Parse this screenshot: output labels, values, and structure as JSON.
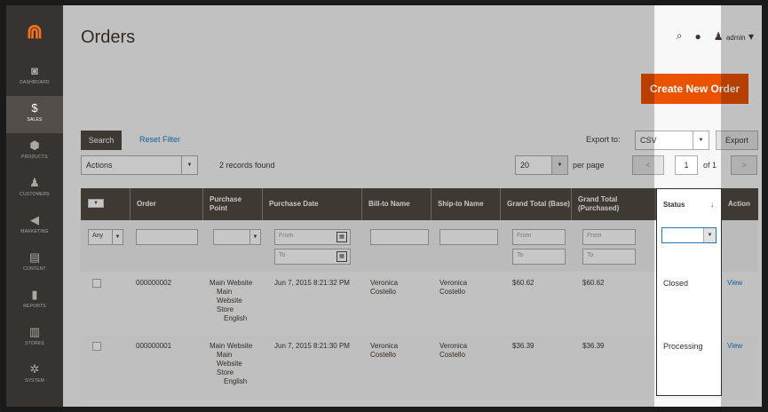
{
  "app": {
    "title": "Orders",
    "create_button": "Create New Order",
    "user": "admin"
  },
  "sidebar": {
    "items": [
      {
        "icon": "dashboard-icon",
        "glyph": "◙",
        "label": "DASHBOARD"
      },
      {
        "icon": "dollar-icon",
        "glyph": "$",
        "label": "SALES",
        "active": true
      },
      {
        "icon": "box-icon",
        "glyph": "⬢",
        "label": "PRODUCTS"
      },
      {
        "icon": "person-icon",
        "glyph": "♟",
        "label": "CUSTOMERS"
      },
      {
        "icon": "megaphone-icon",
        "glyph": "◀",
        "label": "MARKETING"
      },
      {
        "icon": "content-icon",
        "glyph": "▤",
        "label": "CONTENT"
      },
      {
        "icon": "bar-chart-icon",
        "glyph": "▮",
        "label": "REPORTS"
      },
      {
        "icon": "store-icon",
        "glyph": "▥",
        "label": "STORES"
      },
      {
        "icon": "gear-icon",
        "glyph": "✲",
        "label": "SYSTEM"
      }
    ]
  },
  "toolbar": {
    "search": "Search",
    "reset": "Reset Filter",
    "export_to": "Export to:",
    "export_format": "CSV",
    "export": "Export",
    "actions": "Actions",
    "records": "2 records found",
    "per_page_value": "20",
    "per_page": "per page",
    "prev": "<",
    "page": "1",
    "of": "of 1",
    "next": ">"
  },
  "columns": [
    "Order",
    "Purchase Point",
    "Purchase Date",
    "Bill-to Name",
    "Ship-to Name",
    "Grand Total (Base)",
    "Grand Total (Purchased)",
    "Status",
    "Action"
  ],
  "filters": {
    "any": "Any",
    "from": "From",
    "to": "To"
  },
  "rows": [
    {
      "order": "000000002",
      "point": [
        "Main Website",
        "Main",
        "Website",
        "Store",
        "English"
      ],
      "date": "Jun 7, 2015 8:21:32 PM",
      "bill": [
        "Veronica",
        "Costello"
      ],
      "ship": [
        "Veronica",
        "Costello"
      ],
      "base": "$60.62",
      "purchased": "$60.62",
      "status": "Closed",
      "action": "View"
    },
    {
      "order": "000000001",
      "point": [
        "Main Website",
        "Main",
        "Website",
        "Store",
        "English"
      ],
      "date": "Jun 7, 2015 8:21:30 PM",
      "bill": [
        "Veronica",
        "Costello"
      ],
      "ship": [
        "Veronica",
        "Costello"
      ],
      "base": "$36.39",
      "purchased": "$36.39",
      "status": "Processing",
      "action": "View"
    }
  ]
}
